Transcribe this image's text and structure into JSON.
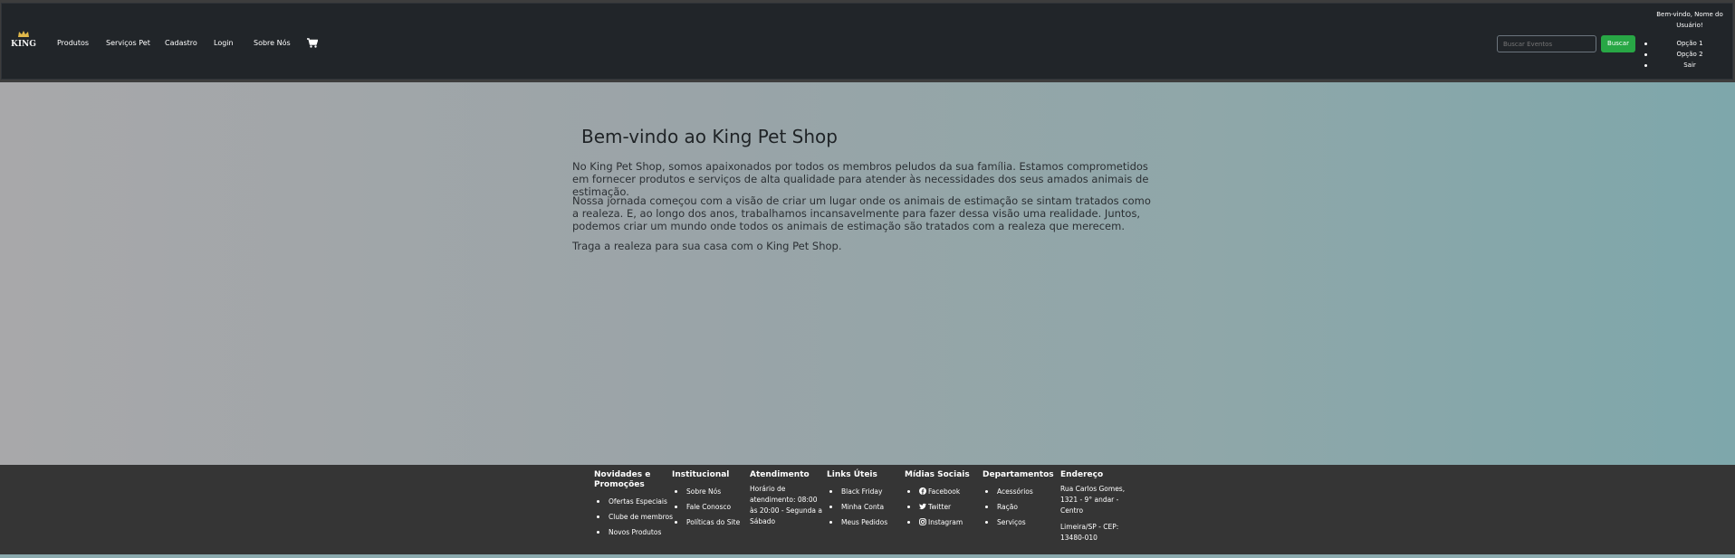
{
  "navbar": {
    "logo_text": "KING",
    "links": [
      "Produtos",
      "Serviços Pet",
      "Cadastro",
      "Login",
      "Sobre Nós"
    ],
    "cart_icon": "cart-icon",
    "search": {
      "placeholder": "Buscar Eventos",
      "button_label": "Buscar"
    },
    "user": {
      "greeting": "Bem-vindo, Nome do Usuário!",
      "menu": [
        "Opção 1",
        "Opção 2",
        "Sair"
      ]
    }
  },
  "main": {
    "title": "Bem-vindo ao King Pet Shop",
    "paragraphs": [
      "No King Pet Shop, somos apaixonados por todos os membros peludos da sua família. Estamos comprometidos em fornecer produtos e serviços de alta qualidade para atender às necessidades dos seus amados animais de estimação.",
      "Nossa jornada começou com a visão de criar um lugar onde os animais de estimação se sintam tratados como a realeza. E, ao longo dos anos, trabalhamos incansavelmente para fazer dessa visão uma realidade. Juntos, podemos criar um mundo onde todos os animais de estimação são tratados com a realeza que merecem.",
      "Traga a realeza para sua casa com o King Pet Shop."
    ]
  },
  "footer": {
    "novidades": {
      "title": "Novidades e Promoções",
      "items": [
        "Ofertas Especiais",
        "Clube de membros",
        "Novos Produtos"
      ]
    },
    "institucional": {
      "title": "Institucional",
      "items": [
        "Sobre Nós",
        "Fale Conosco",
        "Políticas do Site"
      ]
    },
    "atendimento": {
      "title": "Atendimento",
      "text": "Horário de atendimento: 08:00 às 20:00 - Segunda a Sábado"
    },
    "links_uteis": {
      "title": "Links Úteis",
      "items": [
        "Black Friday",
        "Minha Conta",
        "Meus Pedidos"
      ]
    },
    "midias_sociais": {
      "title": "Mídias Sociais",
      "items": [
        "Facebook",
        "Twitter",
        "Instagram"
      ]
    },
    "departamentos": {
      "title": "Departamentos",
      "items": [
        "Acessórios",
        "Ração",
        "Serviços"
      ]
    },
    "endereco": {
      "title": "Endereço",
      "line1": "Rua Carlos Gomes, 1321 - 9° andar - Centro",
      "line2": "Limeira/SP - CEP: 13480-010"
    }
  },
  "colors": {
    "navbar_bg": "#212529",
    "search_button": "#28a745",
    "footer_bg": "#353535",
    "text_dark": "#2b2f33"
  }
}
